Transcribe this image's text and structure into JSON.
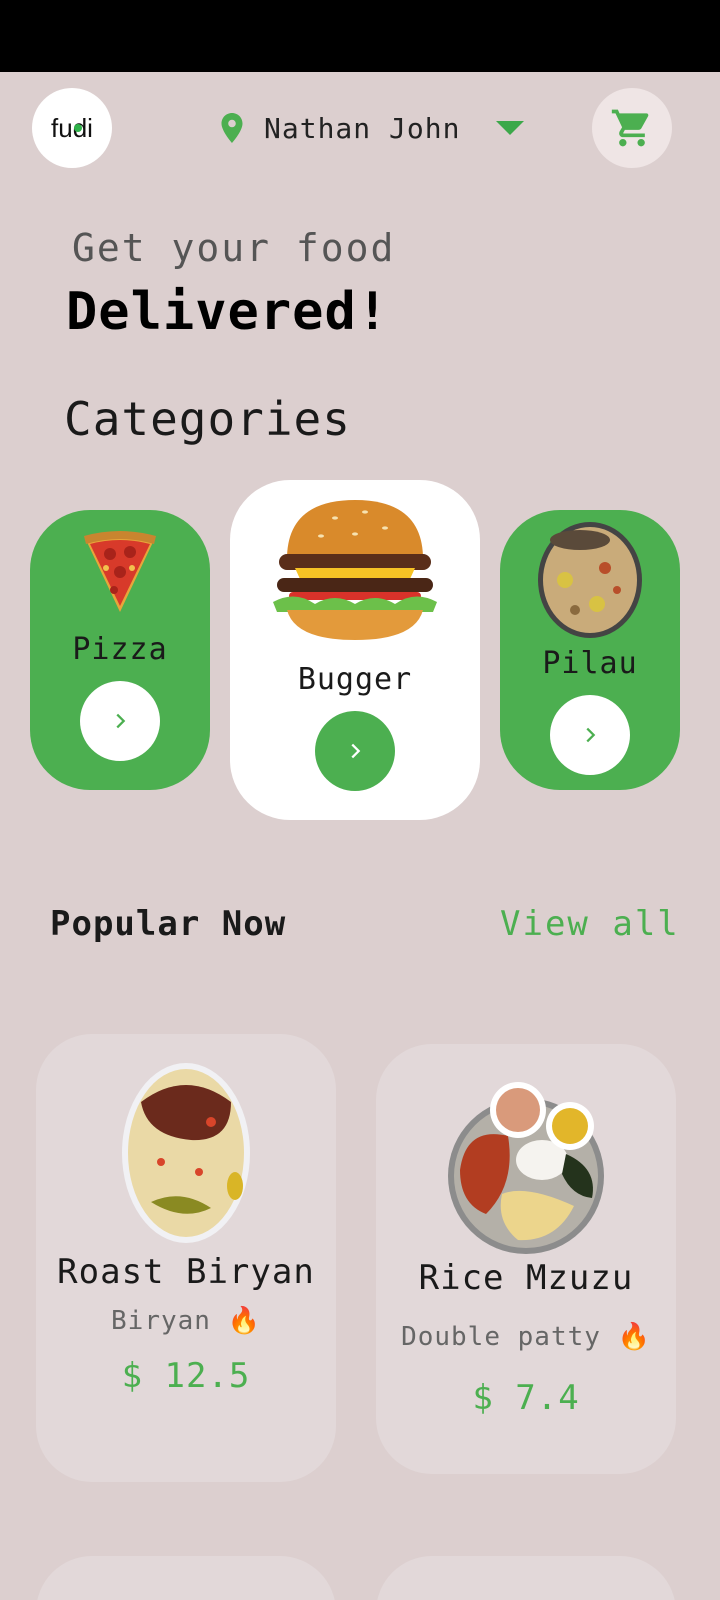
{
  "header": {
    "logo_text": "fudi",
    "location_name": "Nathan John"
  },
  "hero": {
    "line1": "Get your food",
    "line2": "Delivered!"
  },
  "categories": {
    "title": "Categories",
    "items": [
      {
        "label": "Pizza",
        "image": "pizza-slice",
        "style": "green"
      },
      {
        "label": "Bugger",
        "image": "burger",
        "style": "white-selected"
      },
      {
        "label": "Pilau",
        "image": "pilau-plate",
        "style": "green"
      }
    ]
  },
  "popular": {
    "title": "Popular Now",
    "view_all": "View all",
    "items": [
      {
        "name": "Roast Biryan",
        "subtitle": "Biryan",
        "emoji": "🔥",
        "price": "$ 12.5"
      },
      {
        "name": "Rice Mzuzu",
        "subtitle": "Double patty",
        "emoji": "🔥",
        "price": "$ 7.4"
      }
    ]
  },
  "colors": {
    "accent": "#4caf50",
    "background": "#dccfcf",
    "card": "#e2d8d9"
  }
}
